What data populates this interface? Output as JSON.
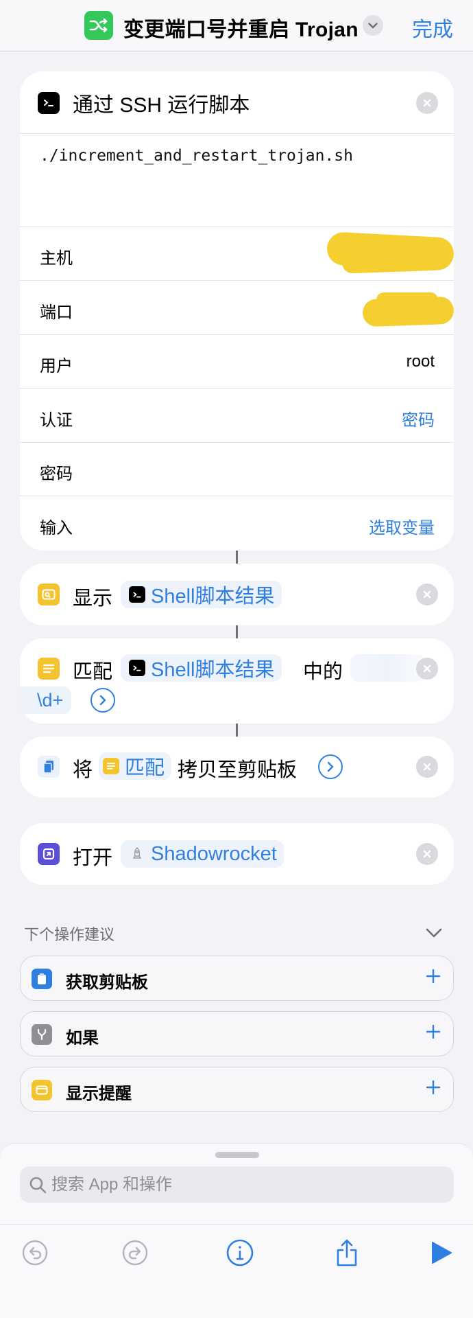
{
  "navbar": {
    "title": "变更端口号并重启 Trojan",
    "done_label": "完成",
    "app_icon": "shuffle-icon",
    "title_menu_icon": "chevron-down-icon"
  },
  "ssh_action": {
    "title": "通过 SSH 运行脚本",
    "script": "./increment_and_restart_trojan.sh",
    "rows": [
      {
        "label": "主机",
        "value": ""
      },
      {
        "label": "端口",
        "value": ""
      },
      {
        "label": "用户",
        "value": "root"
      },
      {
        "label": "认证",
        "value": "密码"
      },
      {
        "label": "密码",
        "value": ""
      },
      {
        "label": "输入",
        "value": "选取变量"
      }
    ]
  },
  "show_action": {
    "label": "显示",
    "token": "Shell脚本结果"
  },
  "match_action": {
    "label": "匹配",
    "token": "Shell脚本结果",
    "middle": "中的",
    "pattern": "\\d+"
  },
  "copy_action": {
    "label_before": "将",
    "token": "匹配",
    "label_after": "拷贝至剪贴板"
  },
  "open_action": {
    "label": "打开",
    "token": "Shadowrocket"
  },
  "suggestions": {
    "heading": "下个操作建议",
    "items": [
      {
        "label": "获取剪贴板",
        "icon": "clipboard-icon",
        "color": "#2f7fe0"
      },
      {
        "label": "如果",
        "icon": "branch-icon",
        "color": "#8e8e93"
      },
      {
        "label": "显示提醒",
        "icon": "alert-icon",
        "color": "#f4c430"
      }
    ]
  },
  "bottom_sheet": {
    "search_placeholder": "搜索 App 和操作"
  },
  "toolbar": {
    "icons": [
      "undo-icon",
      "redo-icon",
      "info-icon",
      "share-icon",
      "play-icon"
    ]
  },
  "colors": {
    "accent": "#2f7fe0",
    "background": "#f2f2f7",
    "redaction": "#f4cf2f"
  }
}
